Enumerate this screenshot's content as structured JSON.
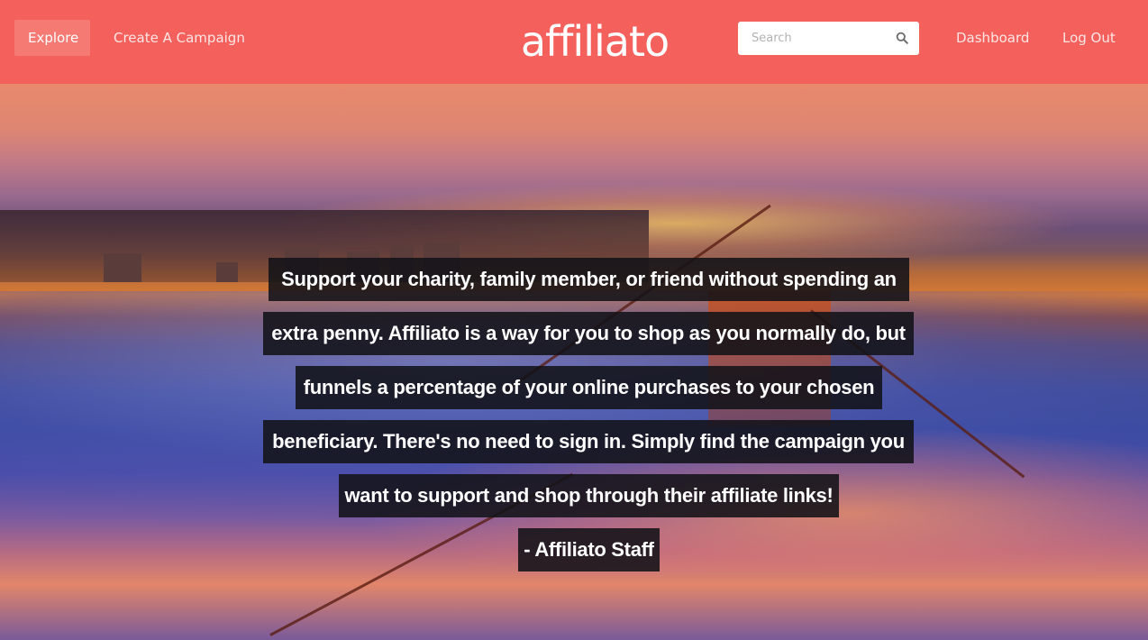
{
  "nav": {
    "explore_label": "Explore",
    "create_label": "Create A Campaign",
    "brand": "affiliato",
    "search_placeholder": "Search",
    "search_value": "",
    "dashboard_label": "Dashboard",
    "logout_label": "Log Out",
    "search_icon": "search-icon"
  },
  "hero": {
    "quote_lines": [
      "Support your charity, family member, or friend without spending an",
      "extra penny. Affiliato is a way for you to shop as you normally do, but",
      "funnels a percentage of your online purchases to your chosen",
      "beneficiary. There's no need to sign in. Simply find the campaign you",
      "want to support and shop through their affiliate links!"
    ],
    "attribution": "- Affiliato Staff"
  },
  "colors": {
    "navbar": "#f4605c",
    "explore_active": "#f57a74",
    "quote_bg": "#121218"
  }
}
